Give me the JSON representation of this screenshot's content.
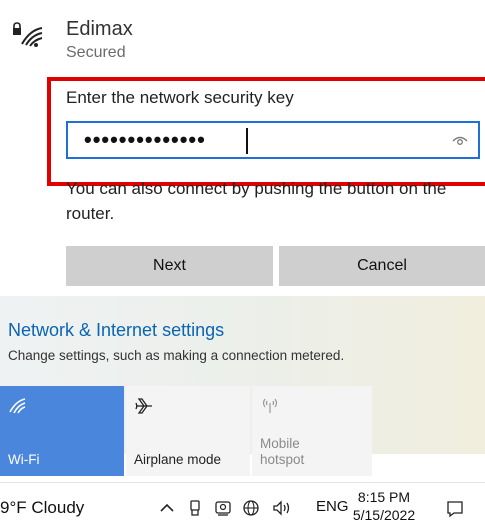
{
  "network": {
    "name": "Edimax",
    "status": "Secured",
    "security_key_label": "Enter the network security key",
    "password_mask": "••••••••••••••",
    "wps_hint": "You can also connect by pushing the button on the router.",
    "next_label": "Next",
    "cancel_label": "Cancel"
  },
  "panel": {
    "settings_link": "Network & Internet settings",
    "settings_sub": "Change settings, such as making a connection metered.",
    "tiles": [
      {
        "label": "Wi-Fi",
        "icon": "wifi-icon"
      },
      {
        "label": "Airplane mode",
        "icon": "airplane-icon"
      },
      {
        "label_line1": "Mobile",
        "label_line2": "hotspot",
        "icon": "hotspot-icon"
      }
    ]
  },
  "taskbar": {
    "weather": "9°F  Cloudy",
    "language": "ENG",
    "time": "8:15 PM",
    "date": "5/15/2022"
  },
  "colors": {
    "highlight": "#e00000",
    "field_border": "#1f6fd6",
    "wifi_tile": "#4a86dc",
    "link": "#0a64b4"
  }
}
